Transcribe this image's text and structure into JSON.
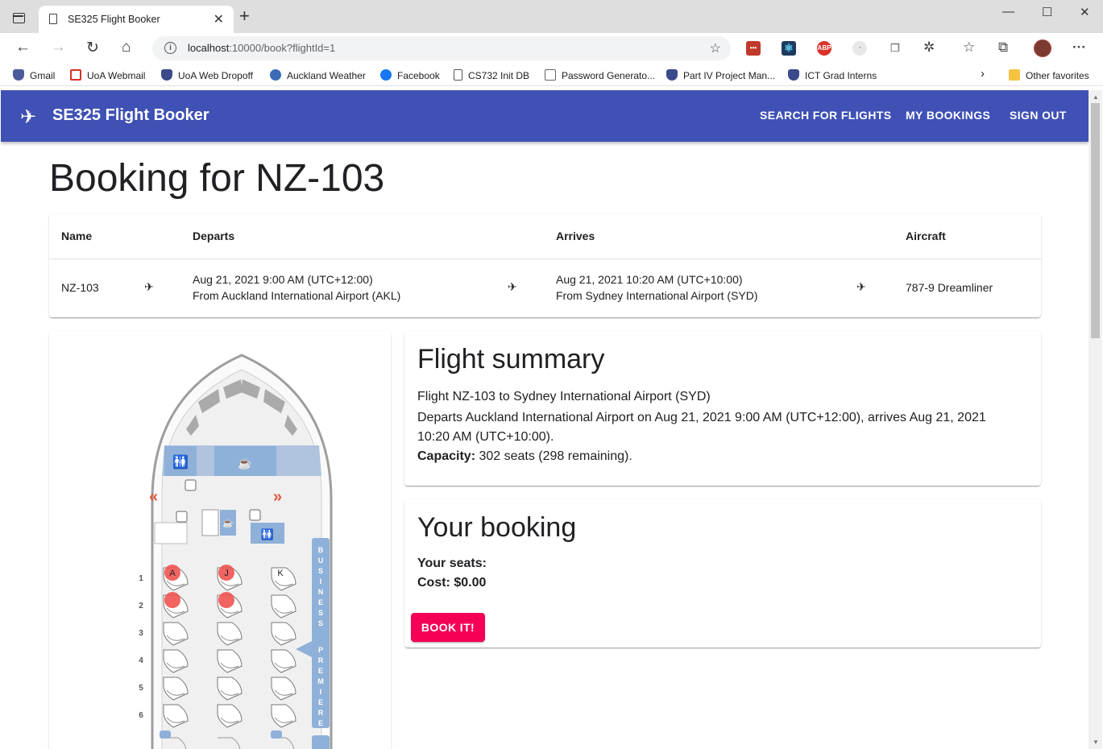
{
  "browser": {
    "tab_title": "SE325 Flight Booker",
    "url_host": "localhost",
    "url_rest": ":10000/book?flightId=1",
    "bookmarks": [
      {
        "label": "Gmail",
        "color": "#4a5a9a"
      },
      {
        "label": "UoA Webmail",
        "color": "#d93025"
      },
      {
        "label": "UoA Web Dropoff",
        "color": "#3a4a8a"
      },
      {
        "label": "Auckland Weather",
        "color": "#3b6bb5"
      },
      {
        "label": "Facebook",
        "color": "#1877f2"
      },
      {
        "label": "CS732 Init DB",
        "color": "#666666"
      },
      {
        "label": "Password Generato...",
        "color": "#5f6368"
      },
      {
        "label": "Part IV Project Man...",
        "color": "#3a4a8a"
      },
      {
        "label": "ICT Grad Interns",
        "color": "#3a4a8a"
      }
    ],
    "other_favorites": "Other favorites"
  },
  "app": {
    "brand": "SE325 Flight Booker",
    "nav": [
      "SEARCH FOR FLIGHTS",
      "MY BOOKINGS",
      "SIGN OUT"
    ],
    "primary_color": "#3f51b5",
    "accent_color": "#f50057"
  },
  "page": {
    "heading": "Booking for NZ-103"
  },
  "flight_table": {
    "headers": {
      "name": "Name",
      "departs": "Departs",
      "arrives": "Arrives",
      "aircraft": "Aircraft"
    },
    "row": {
      "name": "NZ-103",
      "depart_time": "Aug 21, 2021 9:00 AM (UTC+12:00)",
      "depart_from": "From Auckland International Airport (AKL)",
      "arrive_time": "Aug 21, 2021 10:20 AM (UTC+10:00)",
      "arrive_from": "From Sydney International Airport (SYD)",
      "aircraft": "787-9 Dreamliner"
    }
  },
  "summary": {
    "title": "Flight summary",
    "line1": "Flight NZ-103 to Sydney International Airport (SYD)",
    "line2": "Departs Auckland International Airport on Aug 21, 2021 9:00 AM (UTC+12:00), arrives Aug 21, 2021",
    "line3": "10:20 AM (UTC+10:00).",
    "capacity_label": "Capacity:",
    "capacity_value": " 302 seats (298 remaining)."
  },
  "booking": {
    "title": "Your booking",
    "seats_label": "Your seats:",
    "cost_label": "Cost: $0.00",
    "button": "BOOK IT!"
  },
  "seatmap": {
    "rows": [
      "1",
      "2",
      "3",
      "4",
      "5",
      "6"
    ],
    "seat_labels": [
      "A",
      "J",
      "K"
    ],
    "cabin_label": "BUSINESS PREMIERE",
    "booked": [
      "1A",
      "1J",
      "2A",
      "2J"
    ]
  }
}
